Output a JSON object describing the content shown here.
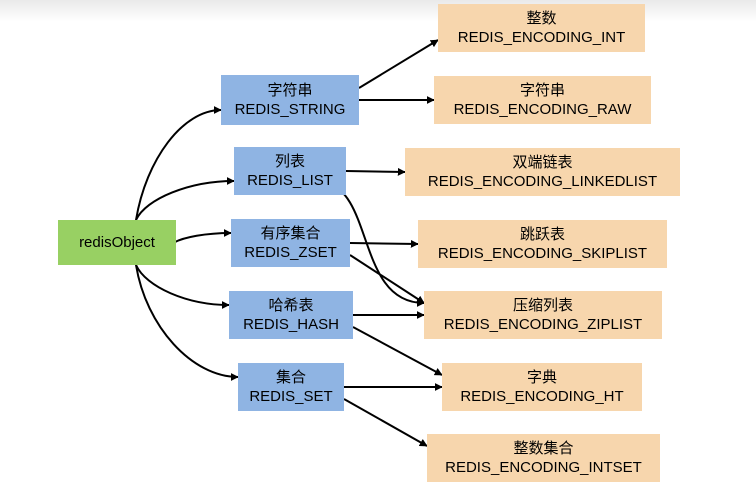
{
  "colors": {
    "root_fill": "#98d063",
    "type_fill": "#8fb4e3",
    "encoding_fill": "#f7d6ad",
    "edge": "#000000"
  },
  "root": {
    "label": "redisObject"
  },
  "types": [
    {
      "cn": "字符串",
      "en": "REDIS_STRING"
    },
    {
      "cn": "列表",
      "en": "REDIS_LIST"
    },
    {
      "cn": "有序集合",
      "en": "REDIS_ZSET"
    },
    {
      "cn": "哈希表",
      "en": "REDIS_HASH"
    },
    {
      "cn": "集合",
      "en": "REDIS_SET"
    }
  ],
  "encodings": [
    {
      "cn": "整数",
      "en": "REDIS_ENCODING_INT"
    },
    {
      "cn": "字符串",
      "en": "REDIS_ENCODING_RAW"
    },
    {
      "cn": "双端链表",
      "en": "REDIS_ENCODING_LINKEDLIST"
    },
    {
      "cn": "跳跃表",
      "en": "REDIS_ENCODING_SKIPLIST"
    },
    {
      "cn": "压缩列表",
      "en": "REDIS_ENCODING_ZIPLIST"
    },
    {
      "cn": "字典",
      "en": "REDIS_ENCODING_HT"
    },
    {
      "cn": "整数集合",
      "en": "REDIS_ENCODING_INTSET"
    }
  ],
  "edges": [
    [
      "root",
      "type_0"
    ],
    [
      "root",
      "type_1"
    ],
    [
      "root",
      "type_2"
    ],
    [
      "root",
      "type_3"
    ],
    [
      "root",
      "type_4"
    ],
    [
      "type_0",
      "enc_0"
    ],
    [
      "type_0",
      "enc_1"
    ],
    [
      "type_1",
      "enc_2"
    ],
    [
      "type_1",
      "enc_4"
    ],
    [
      "type_2",
      "enc_3"
    ],
    [
      "type_2",
      "enc_4"
    ],
    [
      "type_3",
      "enc_4"
    ],
    [
      "type_3",
      "enc_5"
    ],
    [
      "type_4",
      "enc_5"
    ],
    [
      "type_4",
      "enc_6"
    ]
  ]
}
